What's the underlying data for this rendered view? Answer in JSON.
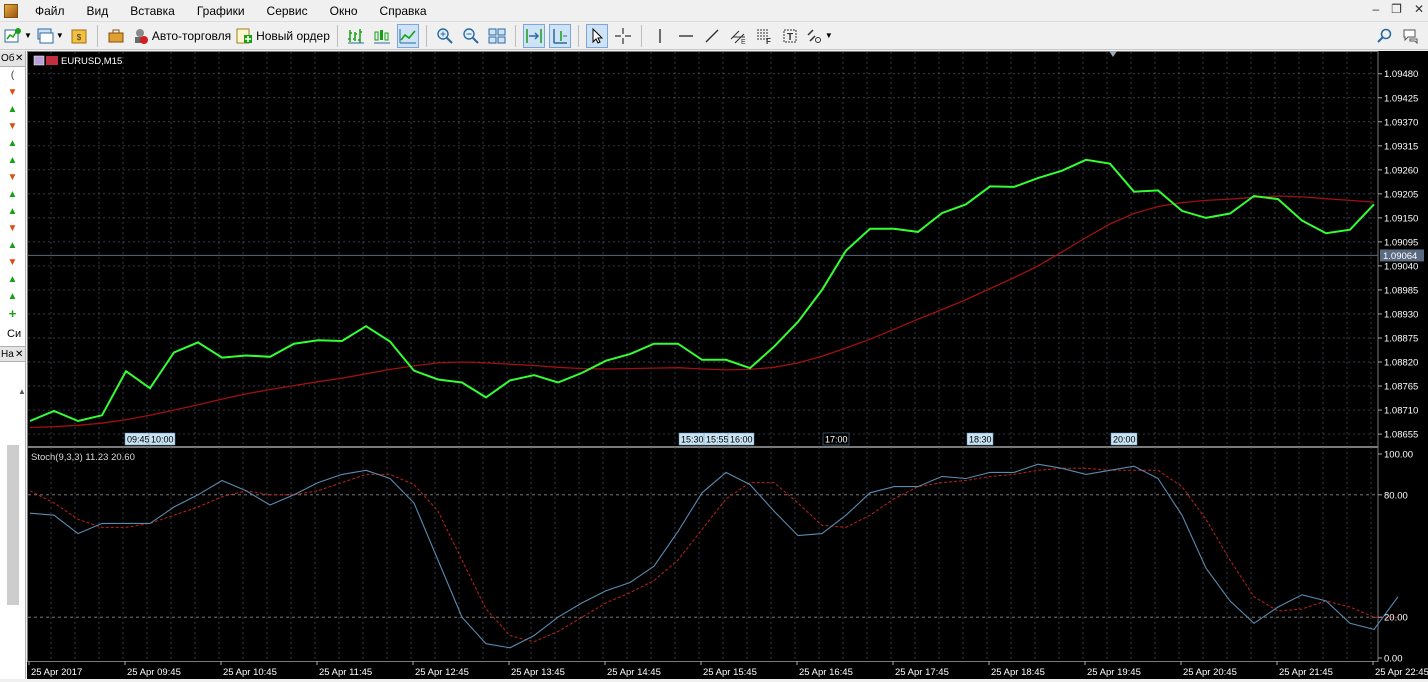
{
  "menu": {
    "items": [
      "Файл",
      "Вид",
      "Вставка",
      "Графики",
      "Сервис",
      "Окно",
      "Справка"
    ]
  },
  "toolbar": {
    "autotrade_label": "Авто-торговля",
    "new_order_label": "Новый ордер"
  },
  "left_panel": {
    "top_header": "Об",
    "bottom_label": "Си",
    "bottom_header": "На",
    "first_row": "(",
    "arrows": [
      "down",
      "up",
      "down",
      "up",
      "up",
      "down",
      "up",
      "up",
      "down",
      "up",
      "down",
      "up",
      "up"
    ],
    "add_symbol": "+"
  },
  "colors": {
    "background": "#000000",
    "grid": "#4a5560",
    "price_line": "#33ff33",
    "ma_line": "#a01010",
    "stoch_main": "#5a8ab0",
    "stoch_signal": "#c02020",
    "axis_text": "#ffffff"
  },
  "chart_data": [
    {
      "type": "line",
      "title": "EURUSD,M15",
      "symbol": "EURUSD",
      "timeframe": "M15",
      "y_ticks": [
        "1.09480",
        "1.09425",
        "1.09370",
        "1.09315",
        "1.09260",
        "1.09205",
        "1.09150",
        "1.09095",
        "1.09040",
        "1.08985",
        "1.08930",
        "1.08875",
        "1.08820",
        "1.08765",
        "1.08710",
        "1.08655"
      ],
      "ylim": [
        1.0863,
        1.095
      ],
      "current_price": "1.09064",
      "time_labels": [
        "09:45",
        "10:00",
        "15:30",
        "15:55",
        "16:00",
        "17:00",
        "18:30",
        "20:00"
      ],
      "grid": true,
      "series": [
        {
          "values": [
            1.08685,
            1.08708,
            1.08685,
            1.08698,
            1.08799,
            1.0876,
            1.08842,
            1.08865,
            1.0883,
            1.08835,
            1.08832,
            1.08862,
            1.0887,
            1.08868,
            1.08902,
            1.08867,
            1.088,
            1.0878,
            1.08773,
            1.08739,
            1.08778,
            1.0879,
            1.08773,
            1.08795,
            1.08823,
            1.08838,
            1.08862,
            1.08862,
            1.08825,
            1.08825,
            1.08806,
            1.08855,
            1.08912,
            1.08985,
            1.09075,
            1.09125,
            1.09125,
            1.09118,
            1.09161,
            1.09181,
            1.09222,
            1.09221,
            1.09241,
            1.09258,
            1.09283,
            1.09274,
            1.0921,
            1.09213,
            1.09166,
            1.0915,
            1.0916,
            1.092,
            1.09193,
            1.09144,
            1.09115,
            1.09123,
            1.09181
          ]
        },
        {
          "values": [
            1.0867,
            1.08672,
            1.08675,
            1.0868,
            1.08688,
            1.08698,
            1.0871,
            1.08722,
            1.08735,
            1.08747,
            1.08757,
            1.08766,
            1.08775,
            1.08783,
            1.08793,
            1.08803,
            1.08811,
            1.08818,
            1.0882,
            1.08818,
            1.08815,
            1.08812,
            1.08808,
            1.08805,
            1.08804,
            1.08805,
            1.08806,
            1.08807,
            1.08804,
            1.08802,
            1.08803,
            1.08808,
            1.08818,
            1.08833,
            1.08852,
            1.08872,
            1.08895,
            1.08918,
            1.0894,
            1.08963,
            1.08988,
            1.09013,
            1.0904,
            1.09072,
            1.09105,
            1.09136,
            1.0916,
            1.09176,
            1.09185,
            1.0919,
            1.09193,
            1.09197,
            1.092,
            1.09198,
            1.09194,
            1.0919,
            1.09186
          ]
        }
      ]
    },
    {
      "type": "line",
      "title": "Stoch(9,3,3) 11.23 20.60",
      "y_ticks": [
        "100.00",
        "80.00",
        "20.00",
        "0.00"
      ],
      "ylim": [
        0,
        100
      ],
      "x_labels": [
        "25 Apr 2017",
        "25 Apr 09:45",
        "25 Apr 10:45",
        "25 Apr 11:45",
        "25 Apr 12:45",
        "25 Apr 13:45",
        "25 Apr 14:45",
        "25 Apr 15:45",
        "25 Apr 16:45",
        "25 Apr 17:45",
        "25 Apr 18:45",
        "25 Apr 19:45",
        "25 Apr 20:45",
        "25 Apr 21:45",
        "25 Apr 22:45"
      ],
      "grid": true,
      "series": [
        {
          "values": [
            71,
            70,
            61,
            66,
            66,
            66,
            74,
            80,
            87,
            82,
            75,
            80,
            86,
            90,
            92,
            88,
            76,
            48,
            20,
            7,
            5,
            11,
            20,
            27,
            33,
            37,
            45,
            62,
            81,
            91,
            85,
            72,
            60,
            61,
            70,
            81,
            84,
            84,
            89,
            88,
            91,
            91,
            95,
            93,
            90,
            92,
            94,
            88,
            70,
            44,
            28,
            17,
            25,
            31,
            28,
            17,
            14,
            30
          ]
        },
        {
          "values": [
            82,
            76,
            68,
            64,
            64,
            66,
            70,
            74,
            79,
            82,
            80,
            80,
            82,
            86,
            90,
            90,
            85,
            72,
            48,
            24,
            11,
            8,
            13,
            20,
            27,
            32,
            38,
            48,
            63,
            78,
            86,
            86,
            76,
            65,
            64,
            70,
            78,
            84,
            86,
            87,
            89,
            90,
            92,
            93,
            93,
            92,
            92,
            92,
            84,
            68,
            48,
            30,
            23,
            24,
            28,
            25,
            20,
            20
          ]
        }
      ]
    }
  ]
}
